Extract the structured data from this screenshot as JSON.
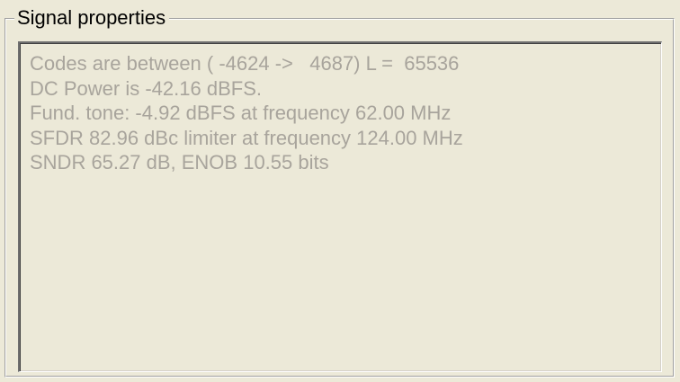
{
  "groupbox": {
    "title": "Signal properties"
  },
  "properties": {
    "lines": [
      "Codes are between ( -4624 ->   4687) L =  65536",
      "DC Power is -42.16 dBFS.",
      "Fund. tone: -4.92 dBFS at frequency 62.00 MHz",
      "SFDR 82.96 dBc limiter at frequency 124.00 MHz",
      "SNDR 65.27 dB, ENOB 10.55 bits"
    ]
  },
  "colors": {
    "window_background": "#ece9d8",
    "disabled_text": "#a8a49c",
    "legend_text": "#000000"
  }
}
